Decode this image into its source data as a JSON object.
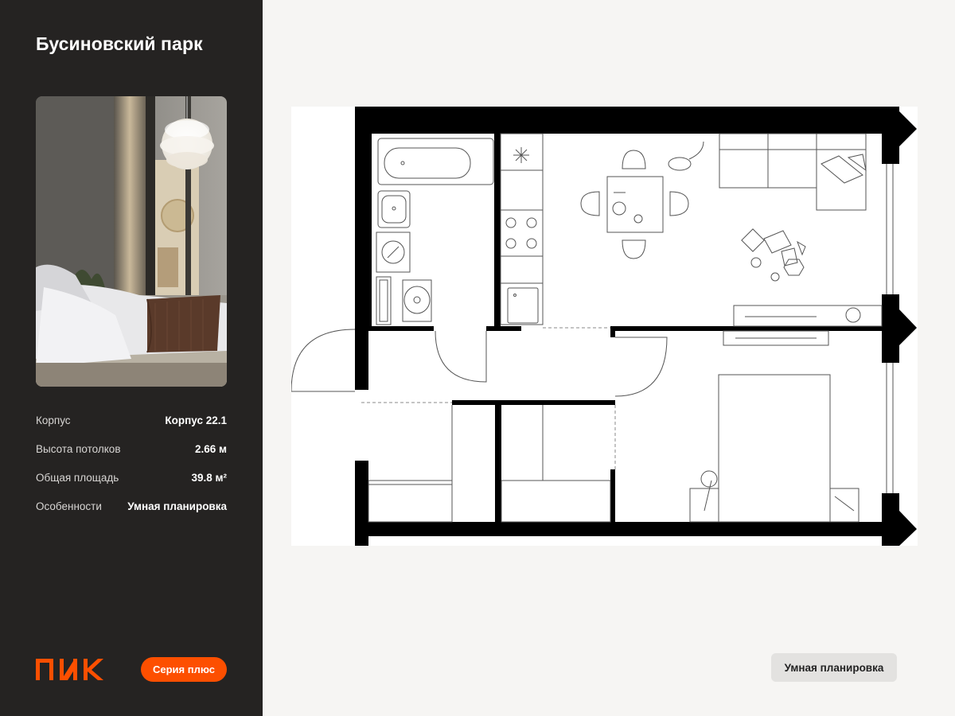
{
  "project": {
    "title": "Бусиновский парк"
  },
  "specs": [
    {
      "label": "Корпус",
      "value": "Корпус 22.1"
    },
    {
      "label": "Высота потолков",
      "value": "2.66 м"
    },
    {
      "label": "Общая площадь",
      "value": "39.8 м²"
    },
    {
      "label": "Особенности",
      "value": "Умная планировка"
    }
  ],
  "brand": {
    "logo_text": "ПИК",
    "accent": "#fd4f00"
  },
  "series_button": {
    "label": "Серия плюс"
  },
  "feature_badge": {
    "label": "Умная планировка"
  },
  "photo": {
    "description_icon": "interior-photo"
  },
  "colors": {
    "sidebar_bg": "#252322",
    "page_bg": "#f6f5f3",
    "wall": "#000000"
  }
}
